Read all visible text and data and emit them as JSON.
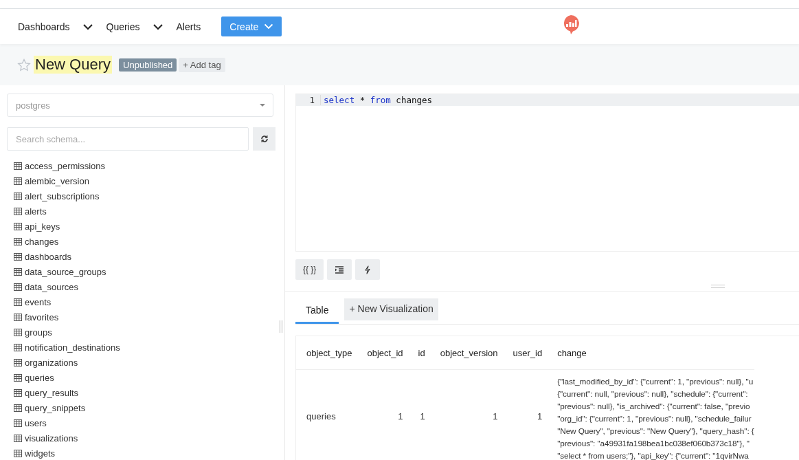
{
  "nav": {
    "items": [
      {
        "label": "Dashboards",
        "dropdown": true
      },
      {
        "label": "Queries",
        "dropdown": true
      },
      {
        "label": "Alerts",
        "dropdown": false
      }
    ],
    "create": "Create"
  },
  "query": {
    "title": "New Query",
    "favorite": false,
    "status": "Unpublished",
    "add_tag": "+ Add tag"
  },
  "schema": {
    "data_source": "postgres",
    "search_placeholder": "Search schema...",
    "tables": [
      "access_permissions",
      "alembic_version",
      "alert_subscriptions",
      "alerts",
      "api_keys",
      "changes",
      "dashboards",
      "data_source_groups",
      "data_sources",
      "events",
      "favorites",
      "groups",
      "notification_destinations",
      "organizations",
      "queries",
      "query_results",
      "query_snippets",
      "users",
      "visualizations",
      "widgets"
    ]
  },
  "editor": {
    "lines": [
      {
        "number": "1",
        "tokens": [
          {
            "text": "select",
            "kind": "keyword"
          },
          {
            "text": " * ",
            "kind": "plain"
          },
          {
            "text": "from",
            "kind": "keyword"
          },
          {
            "text": " changes",
            "kind": "plain"
          }
        ]
      }
    ],
    "buttons": [
      {
        "label": "{{ }}",
        "kind": "text"
      },
      {
        "kind": "indent"
      },
      {
        "kind": "bolt"
      }
    ]
  },
  "results": {
    "tabs": [
      {
        "label": "Table",
        "selected": true
      },
      {
        "label": "+ New Visualization",
        "selected": false
      }
    ],
    "table": {
      "columns": [
        "object_type",
        "object_id",
        "id",
        "object_version",
        "user_id",
        "change"
      ],
      "rows": [
        {
          "object_type": "queries",
          "object_id": "1",
          "id": "1",
          "object_version": "1",
          "user_id": "1",
          "change": [
            "{\"last_modified_by_id\": {\"current\": 1, \"previous\": null}, \"u",
            "{\"current\": null, \"previous\": null}, \"schedule\": {\"current\":",
            "\"previous\": null}, \"is_archived\": {\"current\": false, \"previo",
            "\"org_id\": {\"current\": 1, \"previous\": null}, \"schedule_failur",
            "\"New Query\", \"previous\": \"New Query\"}, \"query_hash\": {",
            "\"previous\": \"a49931fa198bea1bc038ef060b373c18\"}, \"",
            "\"select * from users;\"}, \"api_key\": {\"current\": \"1qvirNwa"
          ]
        }
      ]
    }
  }
}
